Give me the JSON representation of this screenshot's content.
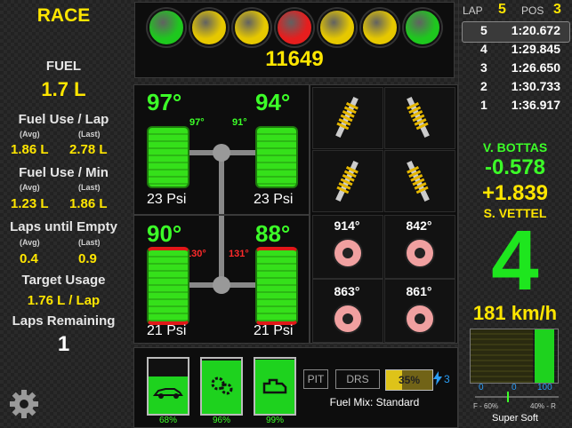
{
  "session": {
    "title": "RACE"
  },
  "lights": {
    "colors": [
      "#1ec81e",
      "#e6c800",
      "#e6c800",
      "#e61e1e",
      "#e6c800",
      "#e6c800",
      "#1ec81e"
    ]
  },
  "rpm": "11649",
  "fuel": {
    "label": "FUEL",
    "value": "1.7 L",
    "use_per_lap": {
      "label": "Fuel Use / Lap",
      "avg_label": "(Avg)",
      "last_label": "(Last)",
      "avg": "1.86 L",
      "last": "2.78 L"
    },
    "use_per_min": {
      "label": "Fuel Use / Min",
      "avg_label": "(Avg)",
      "last_label": "(Last)",
      "avg": "1.23 L",
      "last": "1.86 L"
    },
    "laps_until_empty": {
      "label": "Laps until Empty",
      "avg_label": "(Avg)",
      "last_label": "(Last)",
      "avg": "0.4",
      "last": "0.9"
    },
    "target": {
      "label": "Target Usage",
      "value": "1.76 L / Lap"
    },
    "laps_remaining": {
      "label": "Laps Remaining",
      "value": "1"
    }
  },
  "tires": {
    "fl": {
      "temp": "97°",
      "inner": "97°",
      "psi": "23 Psi"
    },
    "fr": {
      "temp": "94°",
      "inner": "91°",
      "psi": "23 Psi"
    },
    "rl": {
      "temp": "90°",
      "inner": "130°",
      "psi": "21 Psi"
    },
    "rr": {
      "temp": "88°",
      "inner": "131°",
      "psi": "21 Psi"
    }
  },
  "brakes": {
    "fl": "914°",
    "fr": "842°",
    "rl": "863°",
    "rr": "861°"
  },
  "damage": {
    "body": "68%",
    "gearbox": "96%",
    "engine": "99%",
    "body_level": 0.68,
    "gearbox_level": 0.96,
    "engine_level": 0.99
  },
  "controls": {
    "pit": "PIT",
    "drs": "DRS",
    "ers": "35%",
    "ers_level": 0.35,
    "ers_mode": "3",
    "fuel_mix": "Fuel Mix: Standard"
  },
  "standings": {
    "lap_label": "LAP",
    "lap": "5",
    "pos_label": "POS",
    "pos": "3",
    "laps": [
      {
        "n": "5",
        "time": "1:20.672"
      },
      {
        "n": "4",
        "time": "1:29.845"
      },
      {
        "n": "3",
        "time": "1:26.650"
      },
      {
        "n": "2",
        "time": "1:30.733"
      },
      {
        "n": "1",
        "time": "1:36.917"
      }
    ]
  },
  "gap": {
    "ahead_name": "V. BOTTAS",
    "ahead_gap": "-0.578",
    "behind_gap": "+1.839",
    "behind_name": "S. VETTEL"
  },
  "gear": "4",
  "speed": "181 km/h",
  "pedals": {
    "brake_axis": "0",
    "throttle_axis_0": "0",
    "throttle_axis_100": "100",
    "balance_left": "F - 60%",
    "balance_right": "40% - R",
    "throttle_level": 1.0
  },
  "tyre_compound": "Super Soft"
}
